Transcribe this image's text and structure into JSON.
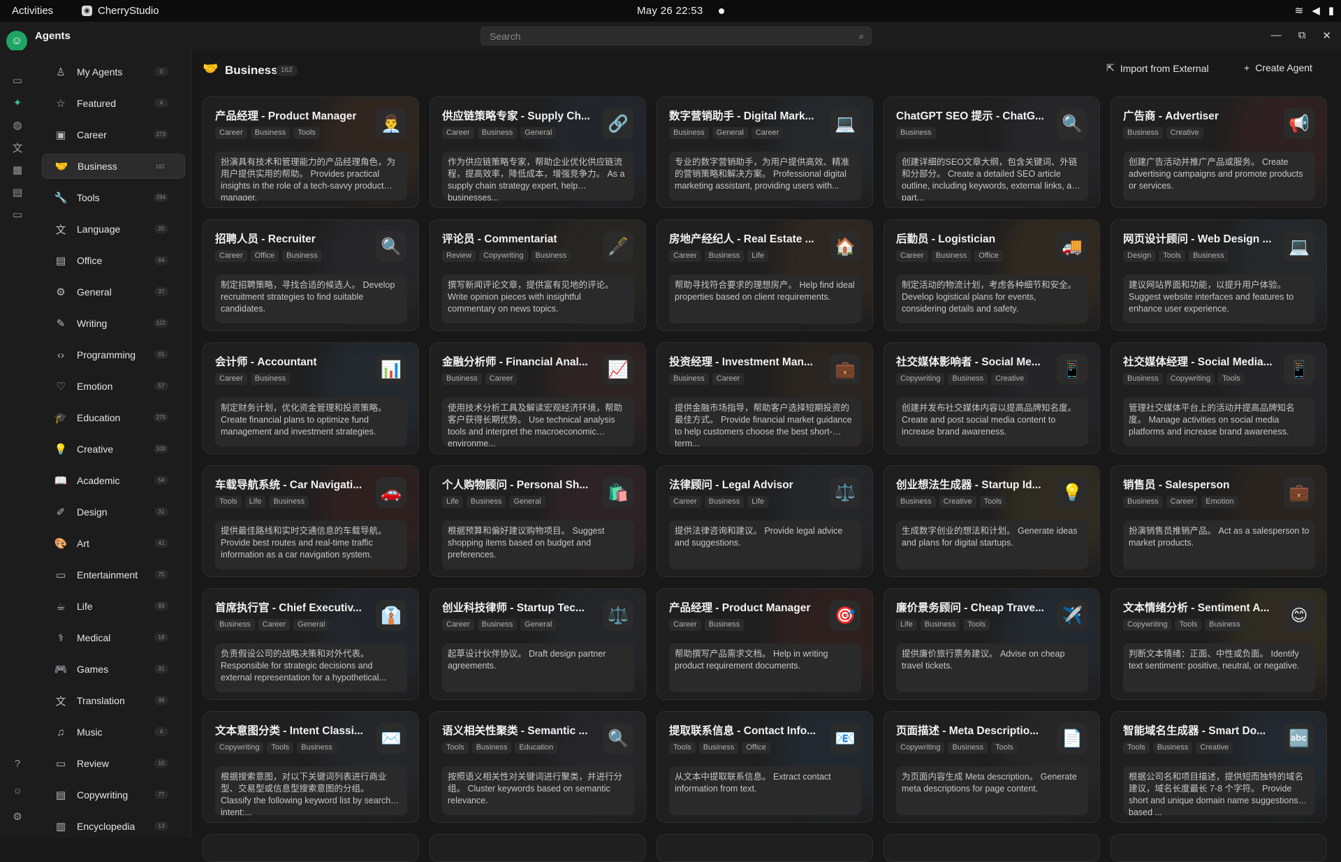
{
  "topbar": {
    "activities": "Activities",
    "app_name": "CherryStudio",
    "clock": "May 26  22:53"
  },
  "app": {
    "title": "Agents",
    "search_placeholder": "Search"
  },
  "rail": [
    "chat-icon",
    "agents-icon",
    "paint-icon",
    "translate-icon",
    "apps-icon",
    "knowledge-icon",
    "files-icon",
    "help-icon",
    "theme-icon",
    "settings-icon"
  ],
  "sidebar": {
    "items": [
      {
        "label": "My Agents",
        "count": "0",
        "icon": "user"
      },
      {
        "label": "Featured",
        "count": "4",
        "icon": "star"
      },
      {
        "label": "Career",
        "count": "273",
        "icon": "briefcase"
      },
      {
        "label": "Business",
        "count": "162",
        "icon": "handshake"
      },
      {
        "label": "Tools",
        "count": "284",
        "icon": "wrench"
      },
      {
        "label": "Language",
        "count": "20",
        "icon": "language"
      },
      {
        "label": "Office",
        "count": "64",
        "icon": "document"
      },
      {
        "label": "General",
        "count": "37",
        "icon": "gear"
      },
      {
        "label": "Writing",
        "count": "122",
        "icon": "pen"
      },
      {
        "label": "Programming",
        "count": "01",
        "icon": "code"
      },
      {
        "label": "Emotion",
        "count": "57",
        "icon": "heart"
      },
      {
        "label": "Education",
        "count": "275",
        "icon": "graduation"
      },
      {
        "label": "Creative",
        "count": "100",
        "icon": "bulb"
      },
      {
        "label": "Academic",
        "count": "54",
        "icon": "book"
      },
      {
        "label": "Design",
        "count": "31",
        "icon": "design"
      },
      {
        "label": "Art",
        "count": "41",
        "icon": "palette"
      },
      {
        "label": "Entertainment",
        "count": "75",
        "icon": "game"
      },
      {
        "label": "Life",
        "count": "83",
        "icon": "cup"
      },
      {
        "label": "Medical",
        "count": "18",
        "icon": "stethoscope"
      },
      {
        "label": "Games",
        "count": "31",
        "icon": "gamepad"
      },
      {
        "label": "Translation",
        "count": "48",
        "icon": "translate"
      },
      {
        "label": "Music",
        "count": "4",
        "icon": "music"
      },
      {
        "label": "Review",
        "count": "10",
        "icon": "review"
      },
      {
        "label": "Copywriting",
        "count": "77",
        "icon": "copy"
      },
      {
        "label": "Encyclopedia",
        "count": "13",
        "icon": "encyclopedia"
      }
    ]
  },
  "main": {
    "title": "Business",
    "count": "162",
    "import_label": "Import from External",
    "create_label": "Create Agent",
    "cards": [
      {
        "title": "产品经理 - Product Manager",
        "tags": [
          "Career",
          "Business",
          "Tools"
        ],
        "emoji": "👨‍💼",
        "desc": "扮演具有技术和管理能力的产品经理角色，为用户提供实用的帮助。 Provides practical insights in the role of a tech-savvy product manager.",
        "glow": "#c96a2b"
      },
      {
        "title": "供应链策略专家 - Supply Ch...",
        "tags": [
          "Career",
          "Business",
          "General"
        ],
        "emoji": "🔗",
        "desc": "作为供应链策略专家，帮助企业优化供应链流程，提高效率，降低成本，增强竞争力。 As a supply chain strategy expert, help businesses...",
        "glow": "#4a6fa5"
      },
      {
        "title": "数字营销助手 - Digital Mark...",
        "tags": [
          "Business",
          "General",
          "Career"
        ],
        "emoji": "💻",
        "desc": "专业的数字营销助手，为用户提供高效、精准的营销策略和解决方案。 Professional digital marketing assistant, providing users with...",
        "glow": "#5a7fa0"
      },
      {
        "title": "ChatGPT SEO 提示 - ChatG...",
        "tags": [
          "Business"
        ],
        "emoji": "🔍",
        "desc": "创建详细的SEO文章大纲，包含关键词、外链和分部分。 Create a detailed SEO article outline, including keywords, external links, and part...",
        "glow": "#6a6a8a"
      },
      {
        "title": "广告商 - Advertiser",
        "tags": [
          "Business",
          "Creative"
        ],
        "emoji": "📢",
        "desc": "创建广告活动并推广产品或服务。 Create advertising campaigns and promote products or services.",
        "glow": "#c33b3b"
      },
      {
        "title": "招聘人员 - Recruiter",
        "tags": [
          "Career",
          "Office",
          "Business"
        ],
        "emoji": "🔍",
        "desc": "制定招聘策略，寻找合适的候选人。 Develop recruitment strategies to find suitable candidates.",
        "glow": "#6a6a8a"
      },
      {
        "title": "评论员 - Commentariat",
        "tags": [
          "Review",
          "Copywriting",
          "Business"
        ],
        "emoji": "🖋️",
        "desc": "撰写新闻评论文章，提供富有见地的评论。 Write opinion pieces with insightful commentary on news topics.",
        "glow": "#7a6a4a"
      },
      {
        "title": "房地产经纪人 - Real Estate ...",
        "tags": [
          "Career",
          "Business",
          "Life"
        ],
        "emoji": "🏠",
        "desc": "帮助寻找符合要求的理想房产。 Help find ideal properties based on client requirements.",
        "glow": "#b8703a"
      },
      {
        "title": "后勤员 - Logistician",
        "tags": [
          "Career",
          "Business",
          "Office"
        ],
        "emoji": "🚚",
        "desc": "制定活动的物流计划，考虑各种细节和安全。 Develop logistical plans for events, considering details and safety.",
        "glow": "#d08a2a"
      },
      {
        "title": "网页设计顾问 - Web Design ...",
        "tags": [
          "Design",
          "Tools",
          "Business"
        ],
        "emoji": "💻",
        "desc": "建议网站界面和功能，以提升用户体验。 Suggest website interfaces and features to enhance user experience.",
        "glow": "#5a7fa0"
      },
      {
        "title": "会计师 - Accountant",
        "tags": [
          "Career",
          "Business"
        ],
        "emoji": "📊",
        "desc": "制定财务计划，优化资金管理和投资策略。 Create financial plans to optimize fund management and investment strategies.",
        "glow": "#4a7fc0"
      },
      {
        "title": "金融分析师 - Financial Anal...",
        "tags": [
          "Business",
          "Career"
        ],
        "emoji": "📈",
        "desc": "使用技术分析工具及解读宏观经济环境，帮助客户获得长期优势。 Use technical analysis tools and interpret the macroeconomic environme...",
        "glow": "#b04a4a"
      },
      {
        "title": "投资经理 - Investment Man...",
        "tags": [
          "Business",
          "Career"
        ],
        "emoji": "💼",
        "desc": "提供金融市场指导，帮助客户选择短期投资的最佳方式。 Provide financial market guidance to help customers choose the best short-term...",
        "glow": "#8a5a2a"
      },
      {
        "title": "社交媒体影响者 - Social Me...",
        "tags": [
          "Copywriting",
          "Business",
          "Creative"
        ],
        "emoji": "📱",
        "desc": "创建并发布社交媒体内容以提高品牌知名度。 Create and post social media content to increase brand awareness.",
        "glow": "#5a5a7a"
      },
      {
        "title": "社交媒体经理 - Social Media...",
        "tags": [
          "Business",
          "Copywriting",
          "Tools"
        ],
        "emoji": "📱",
        "desc": "管理社交媒体平台上的活动并提高品牌知名度。 Manage activities on social media platforms and increase brand awareness.",
        "glow": "#5a5a7a"
      },
      {
        "title": "车载导航系统 - Car Navigati...",
        "tags": [
          "Tools",
          "Life",
          "Business"
        ],
        "emoji": "🚗",
        "desc": "提供最佳路线和实时交通信息的车载导航。 Provide best routes and real-time traffic information as a car navigation system.",
        "glow": "#c03030"
      },
      {
        "title": "个人购物顾问 - Personal Sh...",
        "tags": [
          "Life",
          "Business",
          "General"
        ],
        "emoji": "🛍️",
        "desc": "根据预算和偏好建议购物项目。 Suggest shopping items based on budget and preferences.",
        "glow": "#b04a6a"
      },
      {
        "title": "法律顾问 - Legal Advisor",
        "tags": [
          "Career",
          "Business",
          "Life"
        ],
        "emoji": "⚖️",
        "desc": "提供法律咨询和建议。 Provide legal advice and suggestions.",
        "glow": "#5a6a8a"
      },
      {
        "title": "创业想法生成器 - Startup Id...",
        "tags": [
          "Business",
          "Creative",
          "Tools"
        ],
        "emoji": "💡",
        "desc": "生成数字创业的想法和计划。 Generate ideas and plans for digital startups.",
        "glow": "#c0a030"
      },
      {
        "title": "销售员 - Salesperson",
        "tags": [
          "Business",
          "Career",
          "Emotion"
        ],
        "emoji": "💼",
        "desc": "扮演销售员推销产品。 Act as a salesperson to market products.",
        "glow": "#8a5a2a"
      },
      {
        "title": "首席执行官 - Chief Executiv...",
        "tags": [
          "Business",
          "Career",
          "General"
        ],
        "emoji": "👔",
        "desc": "负责假设公司的战略决策和对外代表。 Responsible for strategic decisions and external representation for a hypothetical...",
        "glow": "#4a6fa5"
      },
      {
        "title": "创业科技律师 - Startup Tec...",
        "tags": [
          "Career",
          "Business",
          "General"
        ],
        "emoji": "⚖️",
        "desc": "起草设计伙伴协议。 Draft design partner agreements.",
        "glow": "#5a6a8a"
      },
      {
        "title": "产品经理 - Product Manager",
        "tags": [
          "Career",
          "Business"
        ],
        "emoji": "🎯",
        "desc": "帮助撰写产品需求文档。 Help in writing product requirement documents.",
        "glow": "#c03030"
      },
      {
        "title": "廉价景务顾问 - Cheap Trave...",
        "tags": [
          "Life",
          "Business",
          "Tools"
        ],
        "emoji": "✈️",
        "desc": "提供廉价旅行票务建议。 Advise on cheap travel tickets.",
        "glow": "#4a7fc0"
      },
      {
        "title": "文本情绪分析 - Sentiment A...",
        "tags": [
          "Copywriting",
          "Tools",
          "Business"
        ],
        "emoji": "😊",
        "desc": "判断文本情绪：正面、中性或负面。 Identify text sentiment: positive, neutral, or negative.",
        "glow": "#c0a030"
      },
      {
        "title": "文本意图分类 - Intent Classi...",
        "tags": [
          "Copywriting",
          "Tools",
          "Business"
        ],
        "emoji": "✉️",
        "desc": "根据搜索意图，对以下关键词列表进行商业型、交易型或信息型搜索意图的分组。 Classify the following keyword list by search intent:...",
        "glow": "#5a6a8a"
      },
      {
        "title": "语义相关性聚类 - Semantic ...",
        "tags": [
          "Tools",
          "Business",
          "Education"
        ],
        "emoji": "🔍",
        "desc": "按照语义相关性对关键词进行聚类，并进行分组。 Cluster keywords based on semantic relevance.",
        "glow": "#6a6a8a"
      },
      {
        "title": "提取联系信息 - Contact Info...",
        "tags": [
          "Tools",
          "Business",
          "Office"
        ],
        "emoji": "📧",
        "desc": "从文本中提取联系信息。 Extract contact information from text.",
        "glow": "#4a7fc0"
      },
      {
        "title": "页面描述 - Meta Descriptio...",
        "tags": [
          "Copywriting",
          "Business",
          "Tools"
        ],
        "emoji": "📄",
        "desc": "为页面内容生成 Meta description。 Generate meta descriptions for page content.",
        "glow": "#6a6a6a"
      },
      {
        "title": "智能域名生成器 - Smart Do...",
        "tags": [
          "Tools",
          "Business",
          "Creative"
        ],
        "emoji": "🔤",
        "desc": "根据公司名和项目描述，提供短而独特的域名建议，域名长度最长 7-8 个字符。 Provide short and unique domain name suggestions based ...",
        "glow": "#4a7fc0"
      }
    ]
  }
}
